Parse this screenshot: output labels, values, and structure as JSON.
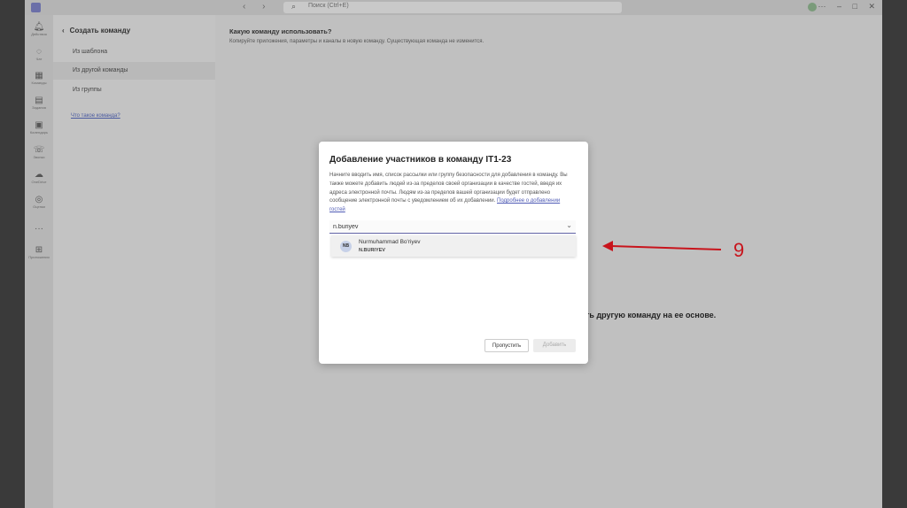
{
  "titlebar": {
    "search_placeholder": "Поиск (Ctrl+E)",
    "nav_arrows": "‹ ›",
    "more": "···",
    "minimize": "–",
    "maximize": "□",
    "close": "✕"
  },
  "rail": {
    "items": [
      {
        "label": "Действия",
        "icon": "bell-icon"
      },
      {
        "label": "Чат",
        "icon": "chat-icon"
      },
      {
        "label": "Команды",
        "icon": "teams-icon"
      },
      {
        "label": "Задания",
        "icon": "assignments-icon"
      },
      {
        "label": "Календарь",
        "icon": "calendar-icon"
      },
      {
        "label": "Звонки",
        "icon": "phone-icon"
      },
      {
        "label": "OneDrive",
        "icon": "cloud-icon"
      },
      {
        "label": "Оценки",
        "icon": "grades-icon"
      },
      {
        "label": "···",
        "icon": "more-icon"
      },
      {
        "label": "Приложения",
        "icon": "apps-icon"
      }
    ]
  },
  "leftpanel": {
    "title": "Создать команду",
    "items": [
      {
        "label": "Из шаблона"
      },
      {
        "label": "Из другой команды"
      },
      {
        "label": "Из группы"
      }
    ],
    "link": "Что такое команда?"
  },
  "main": {
    "heading": "Какую команду использовать?",
    "subtext": "Копируйте приложения, параметры и каналы в новую команду. Существующая команда не изменится.",
    "bg_text": "ть другую команду на ее основе."
  },
  "dialog": {
    "title": "Добавление участников в команду IT1-23",
    "description": "Начните вводить имя, список рассылки или группу безопасности для добавления в команду. Вы также можете добавить людей из-за пределов своей организации в качестве гостей, введя их адреса электронной почты. Людям из-за пределов вашей организации будет отправлено сообщение электронной почты с уведомлением об их добавлении.",
    "link": "Подробнее о добавлении гостей",
    "input_value": "n.buriyev",
    "suggestion": {
      "initials": "NB",
      "name": "Nurmuhammad Bo'riyev",
      "username": "N.BURIYEV"
    },
    "skip_label": "Пропустить",
    "add_label": "Добавить"
  },
  "annotation": {
    "number": "9",
    "color": "#c8141c"
  }
}
